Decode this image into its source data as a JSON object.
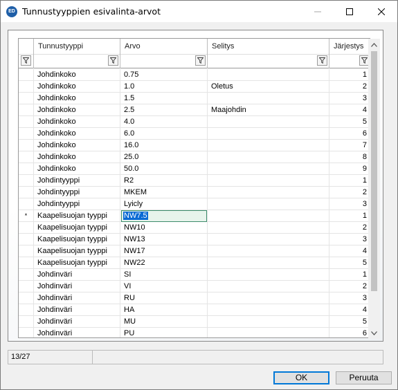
{
  "window": {
    "title": "Tunnustyyppien esivalinta-arvot",
    "icon_text": "ED"
  },
  "grid": {
    "columns": [
      "Tunnustyyppi",
      "Arvo",
      "Selitys",
      "Järjestys"
    ],
    "current_row_indicator": "*",
    "rows": [
      {
        "tyyppi": "Johdinkoko",
        "arvo": "0.75",
        "selitys": "",
        "jarjestys": "1"
      },
      {
        "tyyppi": "Johdinkoko",
        "arvo": "1.0",
        "selitys": "Oletus",
        "jarjestys": "2"
      },
      {
        "tyyppi": "Johdinkoko",
        "arvo": "1.5",
        "selitys": "",
        "jarjestys": "3"
      },
      {
        "tyyppi": "Johdinkoko",
        "arvo": "2.5",
        "selitys": "Maajohdin",
        "jarjestys": "4"
      },
      {
        "tyyppi": "Johdinkoko",
        "arvo": "4.0",
        "selitys": "",
        "jarjestys": "5"
      },
      {
        "tyyppi": "Johdinkoko",
        "arvo": "6.0",
        "selitys": "",
        "jarjestys": "6"
      },
      {
        "tyyppi": "Johdinkoko",
        "arvo": "16.0",
        "selitys": "",
        "jarjestys": "7"
      },
      {
        "tyyppi": "Johdinkoko",
        "arvo": "25.0",
        "selitys": "",
        "jarjestys": "8"
      },
      {
        "tyyppi": "Johdinkoko",
        "arvo": "50.0",
        "selitys": "",
        "jarjestys": "9"
      },
      {
        "tyyppi": "Johdintyyppi",
        "arvo": "R2",
        "selitys": "",
        "jarjestys": "1"
      },
      {
        "tyyppi": "Johdintyyppi",
        "arvo": "MKEM",
        "selitys": "",
        "jarjestys": "2"
      },
      {
        "tyyppi": "Johdintyyppi",
        "arvo": "Lyicly",
        "selitys": "",
        "jarjestys": "3"
      },
      {
        "tyyppi": "Kaapelisuojan tyyppi",
        "arvo": "NW7.5",
        "selitys": "",
        "jarjestys": "1"
      },
      {
        "tyyppi": "Kaapelisuojan tyyppi",
        "arvo": "NW10",
        "selitys": "",
        "jarjestys": "2"
      },
      {
        "tyyppi": "Kaapelisuojan tyyppi",
        "arvo": "NW13",
        "selitys": "",
        "jarjestys": "3"
      },
      {
        "tyyppi": "Kaapelisuojan tyyppi",
        "arvo": "NW17",
        "selitys": "",
        "jarjestys": "4"
      },
      {
        "tyyppi": "Kaapelisuojan tyyppi",
        "arvo": "NW22",
        "selitys": "",
        "jarjestys": "5"
      },
      {
        "tyyppi": "Johdinväri",
        "arvo": "SI",
        "selitys": "",
        "jarjestys": "1"
      },
      {
        "tyyppi": "Johdinväri",
        "arvo": "VI",
        "selitys": "",
        "jarjestys": "2"
      },
      {
        "tyyppi": "Johdinväri",
        "arvo": "RU",
        "selitys": "",
        "jarjestys": "3"
      },
      {
        "tyyppi": "Johdinväri",
        "arvo": "HA",
        "selitys": "",
        "jarjestys": "4"
      },
      {
        "tyyppi": "Johdinväri",
        "arvo": "MU",
        "selitys": "",
        "jarjestys": "5"
      },
      {
        "tyyppi": "Johdinväri",
        "arvo": "PU",
        "selitys": "",
        "jarjestys": "6"
      }
    ],
    "current_row": 12
  },
  "status": {
    "position": "13/27"
  },
  "buttons": {
    "ok": "OK",
    "cancel": "Peruuta"
  },
  "icons": {
    "app": "app-logo-icon",
    "minimize": "minimize-icon",
    "maximize": "maximize-icon",
    "close": "close-icon",
    "filter": "filter-icon"
  },
  "colors": {
    "selection": "#0a6ad4",
    "edit_border": "#3c8c6b",
    "ok_border": "#0078d7"
  }
}
